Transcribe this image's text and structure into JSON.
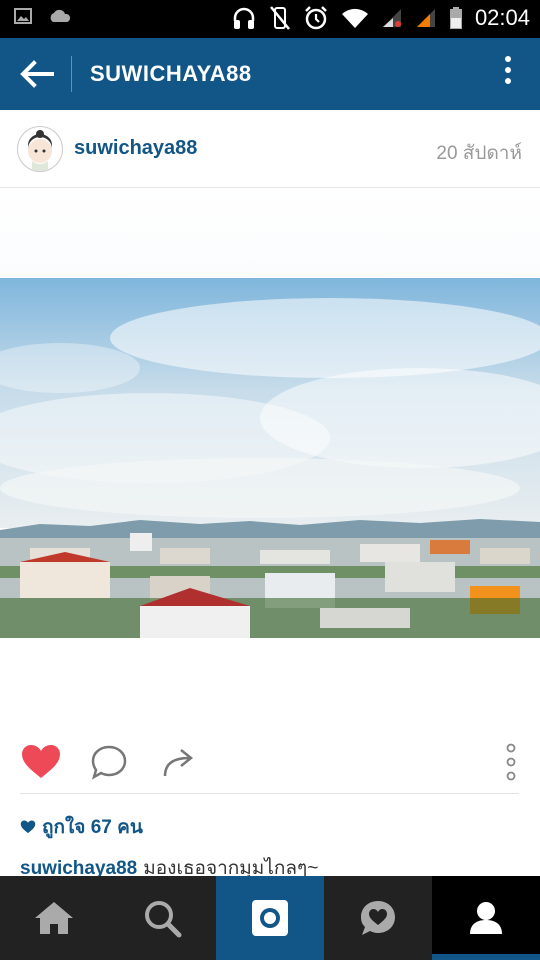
{
  "statusbar": {
    "time": "02:04",
    "icons_left": [
      "image-notification-icon",
      "cloud-icon"
    ],
    "icons_right": [
      "headset-icon",
      "vibrate-off-icon",
      "alarm-icon",
      "wifi-icon",
      "signal-icon",
      "signal-icon",
      "battery-icon"
    ]
  },
  "appbar": {
    "title": "SUWICHAYA88"
  },
  "post": {
    "username": "suwichaya88",
    "time": "20 สัปดาห์",
    "liked": true,
    "likes_text": "ถูกใจ 67 คน",
    "caption_user": "suwichaya88",
    "caption_text": "มองเธอจากมุมไกลๆ~"
  },
  "colors": {
    "accent": "#125688",
    "like": "#ed4956",
    "status_bar": "#000000",
    "bottom_nav": "#222222"
  },
  "bottom_nav": {
    "items": [
      {
        "name": "home",
        "icon": "home-icon"
      },
      {
        "name": "search",
        "icon": "search-icon"
      },
      {
        "name": "camera",
        "icon": "camera-icon"
      },
      {
        "name": "activity",
        "icon": "heart-bubble-icon"
      },
      {
        "name": "profile",
        "icon": "profile-icon"
      }
    ],
    "active": "profile"
  }
}
